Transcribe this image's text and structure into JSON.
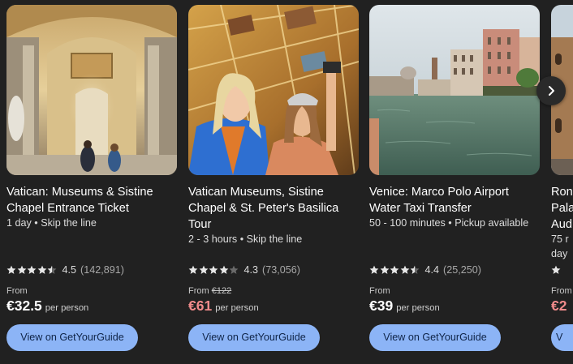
{
  "cards": [
    {
      "title": "Vatican: Museums & Sistine\nChapel Entrance Ticket",
      "meta": "1 day • Skip the line",
      "stars": 4.5,
      "rating": "4.5",
      "reviews": "(142,891)",
      "from_label": "From",
      "old_price": "",
      "price": "€32.5",
      "per_person": "per person",
      "cta": "View on GetYourGuide"
    },
    {
      "title": "Vatican Museums, Sistine\nChapel & St. Peter's Basilica\nTour",
      "meta": "2 - 3 hours • Skip the line",
      "stars": 4.0,
      "rating": "4.3",
      "reviews": "(73,056)",
      "from_label": "From",
      "old_price": "€122",
      "price": "€61",
      "per_person": "per person",
      "cta": "View on GetYourGuide"
    },
    {
      "title": "Venice: Marco Polo Airport\nWater Taxi Transfer",
      "meta": "50 - 100 minutes • Pickup available",
      "stars": 4.5,
      "rating": "4.4",
      "reviews": "(25,250)",
      "from_label": "From",
      "old_price": "",
      "price": "€39",
      "per_person": "per person",
      "cta": "View on GetYourGuide"
    },
    {
      "title": "Ron\nPala\nAud",
      "meta": "75 r\nday",
      "stars": 1,
      "rating": "",
      "reviews": "",
      "from_label": "From",
      "old_price": "",
      "price": "€2",
      "per_person": "",
      "cta": "V"
    }
  ],
  "next_icon": "chevron-right-icon",
  "colors": {
    "background": "#212121",
    "button": "#8cb4f6",
    "button_text": "#0f2447",
    "sale_price": "#f18b8b",
    "star": "#e8e8e8"
  }
}
